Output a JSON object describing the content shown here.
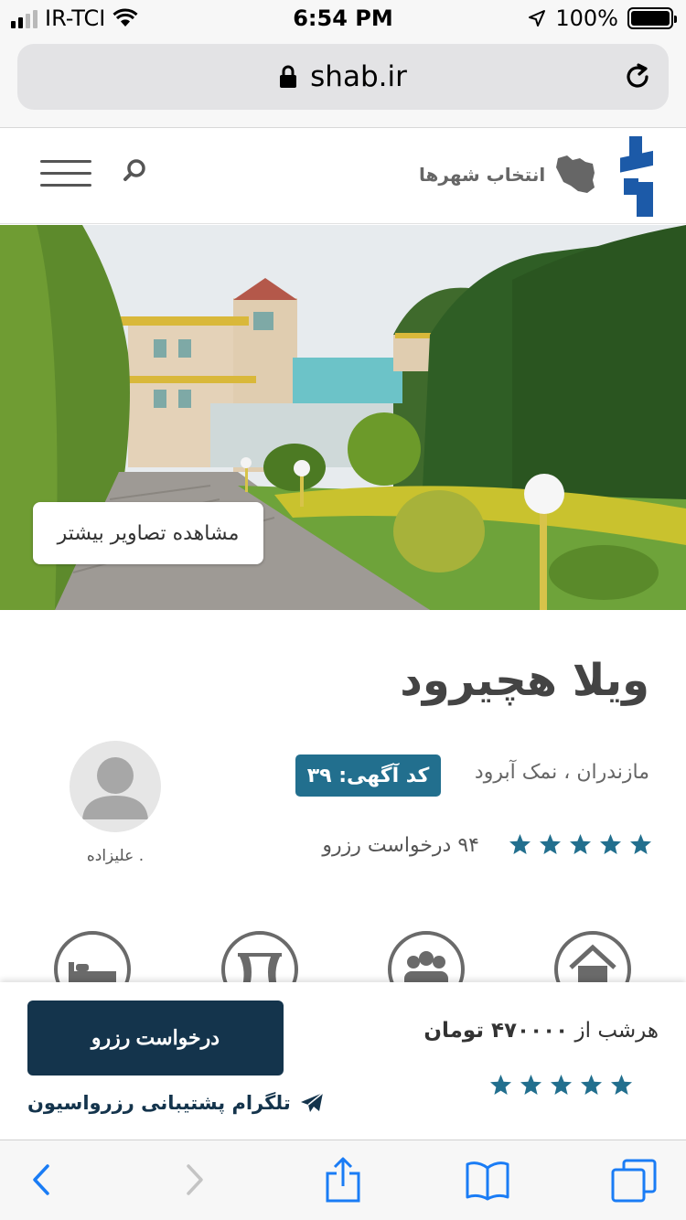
{
  "status_bar": {
    "carrier": "IR-TCI",
    "time": "6:54 PM",
    "battery": "100%",
    "signal_level": 2
  },
  "browser": {
    "url": "shab.ir"
  },
  "header": {
    "city_select_label": "انتخاب شهرها"
  },
  "hero": {
    "more_photos_label": "مشاهده تصاویر بیشتر"
  },
  "listing": {
    "title": "ویلا هچیرود",
    "location": "مازندران ، نمک آبرود",
    "ad_code": "کد آگهی: ۳۹",
    "rating_stars": 5,
    "requests": "۹۴ درخواست رزرو",
    "host_name": ". علیزاده"
  },
  "features": [
    "home-icon",
    "group-icon",
    "curtain-room-icon",
    "bed-icon"
  ],
  "booking": {
    "price_prefix": "هرشب از",
    "price_amount": "۴۷۰۰۰۰ تومان",
    "rating_stars": 5,
    "reserve_label": "درخواست رزرو",
    "telegram_label": "تلگرام پشتیبانی رزرواسیون"
  },
  "colors": {
    "accent": "#226f8e",
    "dark_button": "#14344c",
    "ios_blue": "#1a7cf5"
  }
}
